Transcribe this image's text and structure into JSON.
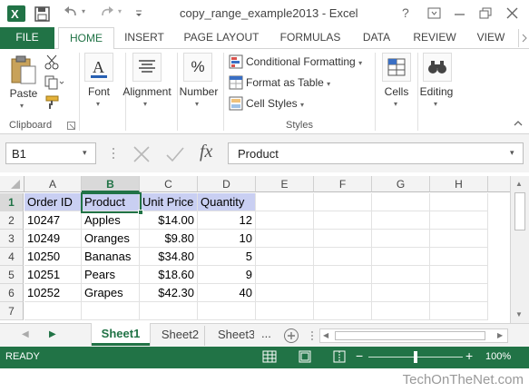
{
  "window": {
    "title": "copy_range_example2013 - Excel",
    "help_label": "?"
  },
  "ribbon_tabs": [
    "FILE",
    "HOME",
    "INSERT",
    "PAGE LAYOUT",
    "FORMULAS",
    "DATA",
    "REVIEW",
    "VIEW"
  ],
  "active_tab": "HOME",
  "ribbon": {
    "paste_label": "Paste",
    "clipboard_label": "Clipboard",
    "font_label": "Font",
    "alignment_label": "Alignment",
    "number_label": "Number",
    "conditional_formatting_label": "Conditional Formatting",
    "format_as_table_label": "Format as Table",
    "cell_styles_label": "Cell Styles",
    "styles_label": "Styles",
    "cells_label": "Cells",
    "editing_label": "Editing",
    "percent_glyph": "%",
    "font_glyph": "A"
  },
  "formula_bar": {
    "name_box": "B1",
    "fx_label": "fx",
    "content": "Product"
  },
  "grid": {
    "columns": [
      "A",
      "B",
      "C",
      "D",
      "E",
      "F",
      "G",
      "H"
    ],
    "active_column": "B",
    "rows": [
      "1",
      "2",
      "3",
      "4",
      "5",
      "6",
      "7"
    ],
    "cells": [
      [
        "Order ID",
        "Product",
        "Unit Price",
        "Quantity"
      ],
      [
        "10247",
        "Apples",
        "$14.00",
        "12"
      ],
      [
        "10249",
        "Oranges",
        "$9.80",
        "10"
      ],
      [
        "10250",
        "Bananas",
        "$34.80",
        "5"
      ],
      [
        "10251",
        "Pears",
        "$18.60",
        "9"
      ],
      [
        "10252",
        "Grapes",
        "$42.30",
        "40"
      ],
      [
        "",
        "",
        "",
        ""
      ]
    ]
  },
  "sheet_tabs": [
    "Sheet1",
    "Sheet2",
    "Sheet3"
  ],
  "active_sheet": "Sheet1",
  "sheet_tab_ellipsis": "...",
  "status": {
    "ready_label": "READY",
    "zoom_minus": "−",
    "zoom_plus": "+",
    "zoom_level": "100%",
    "zoom_fraction": 0.5
  },
  "footer": {
    "watermark": "TechOnTheNet.com"
  },
  "colors": {
    "excel_green": "#217346",
    "header_highlight": "#c9cff2",
    "selection": "#217346"
  }
}
